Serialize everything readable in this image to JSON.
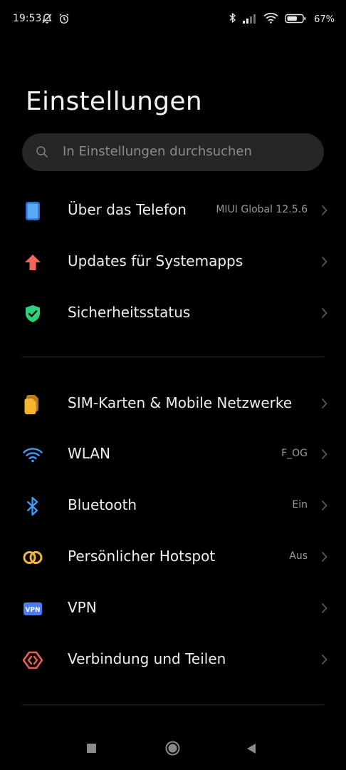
{
  "status_bar": {
    "time": "19:53",
    "battery_percent": "67%",
    "battery_level": 0.67,
    "icons_left": [
      "muted-notification-icon",
      "alarm-icon"
    ],
    "icons_right": [
      "bluetooth-icon",
      "signal-icon",
      "wifi-icon",
      "battery-icon"
    ]
  },
  "header": {
    "title": "Einstellungen"
  },
  "search": {
    "placeholder": "In Einstellungen durchsuchen"
  },
  "sections": [
    {
      "items": [
        {
          "label": "Über das Telefon",
          "value": "MIUI Global 12.5.6",
          "icon": "phone-icon",
          "color": "#4f9cf0"
        },
        {
          "label": "Updates für Systemapps",
          "value": "",
          "icon": "arrow-up-icon",
          "color": "#f2665a"
        },
        {
          "label": "Sicherheitsstatus",
          "value": "",
          "icon": "shield-check-icon",
          "color": "#2fd07a"
        }
      ]
    },
    {
      "items": [
        {
          "label": "SIM-Karten & Mobile Netzwerke",
          "value": "",
          "icon": "sim-card-icon",
          "color": "#f5b62d"
        },
        {
          "label": "WLAN",
          "value": "F_OG",
          "icon": "wifi-icon",
          "color": "#3e9bf5"
        },
        {
          "label": "Bluetooth",
          "value": "Ein",
          "icon": "bluetooth-icon",
          "color": "#3e9bf5"
        },
        {
          "label": "Persönlicher Hotspot",
          "value": "Aus",
          "icon": "hotspot-icon",
          "color": "#f3b43a"
        },
        {
          "label": "VPN",
          "value": "",
          "icon": "vpn-icon",
          "color": "#4a7cf6"
        },
        {
          "label": "Verbindung und Teilen",
          "value": "",
          "icon": "share-icon",
          "color": "#f25c54"
        }
      ]
    }
  ],
  "vpn_badge_text": "VPN",
  "navigation": {
    "buttons": [
      "recents-button",
      "home-button",
      "back-button"
    ]
  }
}
